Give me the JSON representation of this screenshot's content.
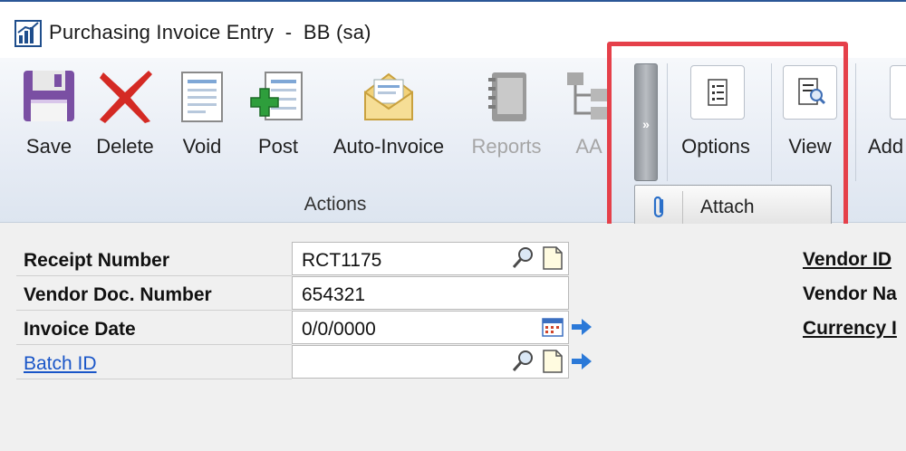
{
  "window": {
    "title": "Purchasing Invoice Entry  -  BB (sa)"
  },
  "ribbon": {
    "buttons": [
      {
        "label": "Save",
        "icon": "floppy-disk-icon"
      },
      {
        "label": "Delete",
        "icon": "red-x-icon"
      },
      {
        "label": "Void",
        "icon": "void-document-icon"
      },
      {
        "label": "Post",
        "icon": "post-document-icon"
      },
      {
        "label": "Auto-Invoice",
        "icon": "envelope-icon"
      },
      {
        "label": "Reports",
        "icon": "notebook-icon",
        "disabled": true
      },
      {
        "label": "AA",
        "icon": "hierarchy-icon",
        "disabled": true
      }
    ],
    "group_label": "Actions",
    "overflow_label": "»",
    "options_label": "Options",
    "view_label": "View",
    "add_label": "Add",
    "attach_label": "Attach"
  },
  "form": {
    "rows": [
      {
        "label": "Receipt Number",
        "value": "RCT1175"
      },
      {
        "label": "Vendor Doc. Number",
        "value": "654321"
      },
      {
        "label": "Invoice Date",
        "value": "0/0/0000"
      },
      {
        "label": "Batch ID",
        "value": ""
      }
    ],
    "right_labels": [
      "Vendor ID",
      "Vendor Na",
      "Currency I"
    ]
  },
  "colors": {
    "highlight": "#e5404a",
    "link": "#1a56c8"
  }
}
